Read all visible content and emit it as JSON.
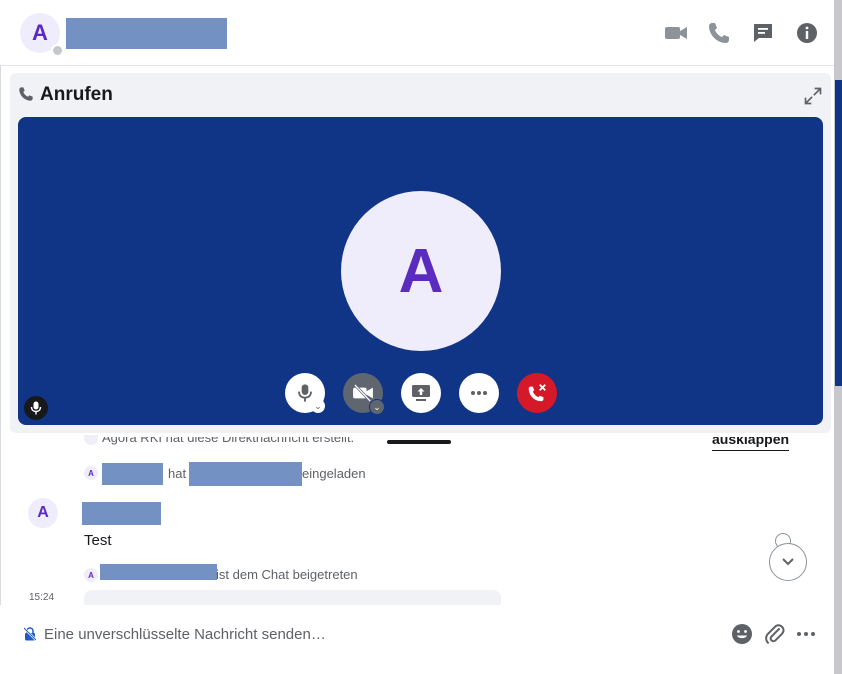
{
  "room": {
    "avatar_letter": "A"
  },
  "call": {
    "title": "Anrufen",
    "avatar_letter": "A"
  },
  "timeline": {
    "created_text": "Agora RKI hat diese Direktnachricht erstellt.",
    "expand_label": "ausklappen",
    "event1": {
      "avatar_letter": "A",
      "verb": "hat",
      "rest": "eingeladen"
    },
    "message": {
      "avatar_letter": "A",
      "body": "Test",
      "time": "15:24"
    },
    "event2": {
      "avatar_letter": "A",
      "rest": "ist dem Chat beigetreten"
    }
  },
  "composer": {
    "placeholder": "Eine unverschlüsselte Nachricht senden…"
  },
  "colors": {
    "video_bg": "#103586",
    "avatar_bg": "#efecfb",
    "avatar_fg": "#5b2bbf",
    "hangup": "#d51928",
    "redaction": "#7391c2"
  },
  "icons": {
    "header": [
      "video-call-icon",
      "voice-call-icon",
      "threads-icon",
      "room-info-icon"
    ],
    "controls": [
      "microphone-icon",
      "camera-off-icon",
      "screenshare-icon",
      "more-icon",
      "hangup-icon"
    ],
    "composer": [
      "emoji-icon",
      "attachment-icon",
      "more-options-icon"
    ]
  }
}
